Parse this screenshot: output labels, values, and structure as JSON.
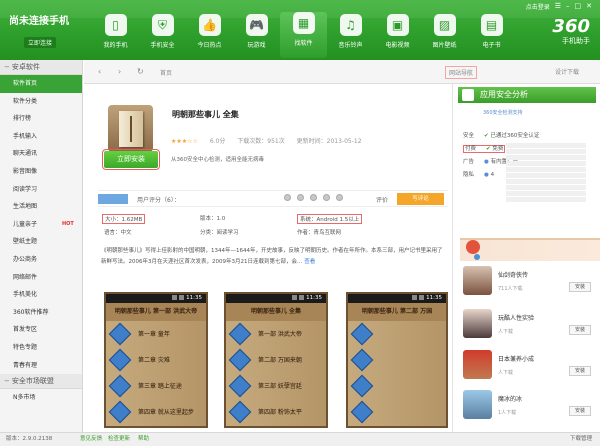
{
  "header": {
    "brand": "尚未连接手机",
    "brand_sub": "立即连接",
    "win_label": "点击登录",
    "nav": [
      {
        "label": "我的手机",
        "icon": "phone-icon"
      },
      {
        "label": "手机安全",
        "icon": "shield-icon"
      },
      {
        "label": "今日热点",
        "icon": "thumbs-up-icon"
      },
      {
        "label": "玩游戏",
        "icon": "gamepad-icon"
      },
      {
        "label": "找软件",
        "icon": "grid-icon",
        "active": true
      },
      {
        "label": "音乐铃声",
        "icon": "music-icon"
      },
      {
        "label": "电影视频",
        "icon": "film-icon"
      },
      {
        "label": "图片壁纸",
        "icon": "picture-icon"
      },
      {
        "label": "电子书",
        "icon": "book-icon"
      }
    ],
    "logo_num": "360",
    "logo_name": "手机助手"
  },
  "sidebar": {
    "section1": "安卓软件",
    "items1": [
      {
        "label": "软件首页",
        "active": true
      },
      {
        "label": "软件分类"
      },
      {
        "label": "排行榜"
      },
      {
        "label": "手机输入"
      },
      {
        "label": "聊天通讯"
      },
      {
        "label": "影音图像"
      },
      {
        "label": "阅读学习"
      },
      {
        "label": "生活地图"
      },
      {
        "label": "儿童亲子",
        "hot": "HOT"
      },
      {
        "label": "壁纸主题"
      },
      {
        "label": "办公商务"
      },
      {
        "label": "网络邮件"
      },
      {
        "label": "手机美化"
      },
      {
        "label": "360软件推荐"
      },
      {
        "label": "首发专区"
      },
      {
        "label": "特色专题"
      },
      {
        "label": "青春有理"
      }
    ],
    "section2": "安全市场联盟",
    "items2": [
      {
        "label": "N多市场"
      }
    ]
  },
  "toolbar": {
    "back": "‹",
    "forward": "›",
    "refresh": "↻",
    "home": "首页",
    "addr_main": "网站导航",
    "addr_right": "设计下载"
  },
  "app": {
    "title": "明朝那些事儿 全集",
    "score": "6.0分",
    "downloads": "下载次数：951次",
    "updated": "更新时间：2013-05-12",
    "install": "立即安装",
    "scan": "从360安全中心检测，适用全能无病毒",
    "user_rating": "用户评分（6）：",
    "rate_label": "评价",
    "write_comment": "写评论",
    "size": "大小：1.62MB",
    "version": "版本：1.0",
    "system": "系统：Android 1.5以上",
    "language": "语言：中文",
    "category": "分类：阅读学习",
    "author": "作者：青鸟互联网",
    "desc": "《明朝那些事儿》写得上佳影射的中国明朝，1344年—1644年，开史故事，反映了明朝历史。作者在年所作。本系三部，用户记书里采用了新鲜写法。2006年3月在天涯社区首次发表，2009年3月21日连载到第七部，会…",
    "more": "查看"
  },
  "screenshots": [
    {
      "time": "11:35",
      "title": "明朝那些事儿 第一部 洪武大帝",
      "chapters": [
        "第一章 童年",
        "第二章 灾难",
        "第三章 踏上征途",
        "第四章 就从这里起步"
      ]
    },
    {
      "time": "11:35",
      "title": "明朝那些事儿 全集",
      "chapters": [
        "第一部 洪武大帝",
        "第二部 万国来朝",
        "第三部 妖孽宫廷",
        "第四部 粉饰太平"
      ]
    },
    {
      "time": "11:35",
      "title": "明朝那些事儿 第二部 万国",
      "chapters": [
        "",
        "",
        "",
        ""
      ]
    }
  ],
  "right": {
    "head": "应用安全分析",
    "sub": "360安全检测支持",
    "rows": [
      {
        "k": "安全",
        "v": "已通过360安全认证",
        "boxed": false
      },
      {
        "k": "付费",
        "v": "免费",
        "boxed": true
      },
      {
        "k": "广告",
        "v": "有内置广告",
        "boxed": false
      },
      {
        "k": "隐私",
        "v": "4",
        "boxed": false
      }
    ],
    "friends": [
      {
        "name": "仙剑奇侠传",
        "sub": "711人下载",
        "btn": "安装"
      },
      {
        "name": "玩酷人性实验",
        "sub": "人下载",
        "btn": "安装"
      },
      {
        "name": "日本兼养小成",
        "sub": "人下载",
        "btn": "安装"
      },
      {
        "name": "魔冰的冰",
        "sub": "1人下载",
        "btn": "安装"
      }
    ]
  },
  "status": {
    "version": "版本：2.9.0.2138",
    "links": [
      "意见反馈",
      "检查更新",
      "帮助"
    ],
    "download": "下载管理"
  }
}
